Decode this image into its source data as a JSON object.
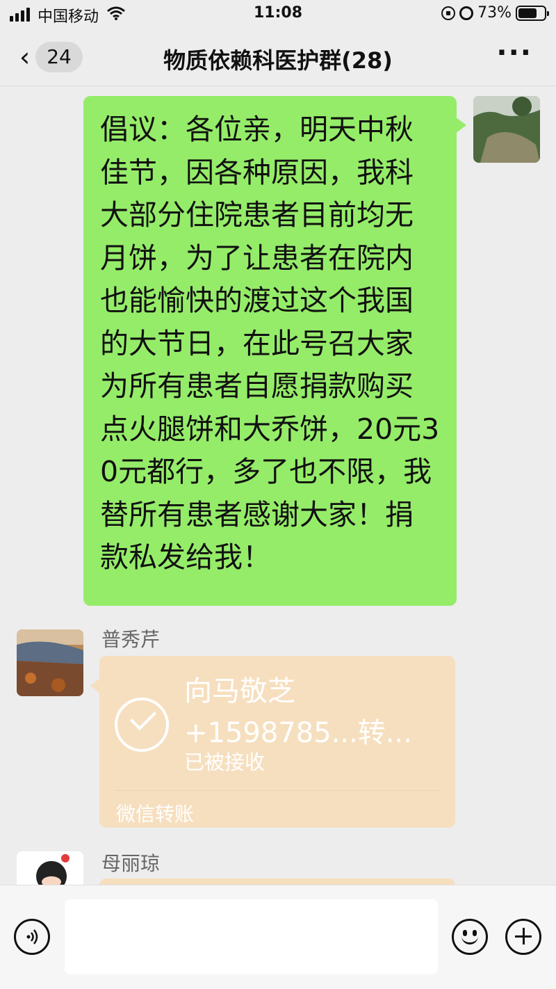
{
  "status_bar": {
    "carrier": "中国移动",
    "time": "11:08",
    "battery": "73%"
  },
  "header": {
    "back_count": "24",
    "title": "物质依赖科医护群(28)"
  },
  "messages": [
    {
      "type": "text",
      "direction": "outgoing",
      "text": "倡议：各位亲，明天中秋佳节，因各种原因，我科大部分住院患者目前均无月饼，为了让患者在院内也能愉快的渡过这个我国的大节日，在此号召大家为所有患者自愿捐款购买点火腿饼和大乔饼，20元30元都行，多了也不限，我替所有患者感谢大家！捐款私发给我！"
    },
    {
      "type": "transfer",
      "direction": "incoming",
      "sender": "普秀芹",
      "recipient": "向马敬芝",
      "phone": "+1598785...转...",
      "status": "已被接收",
      "label": "微信转账"
    },
    {
      "type": "partial",
      "direction": "incoming",
      "sender": "母丽琼"
    }
  ],
  "colors": {
    "outgoing_bubble": "#95ec69",
    "transfer_bubble": "#f6dfbf",
    "background": "#ededed"
  }
}
